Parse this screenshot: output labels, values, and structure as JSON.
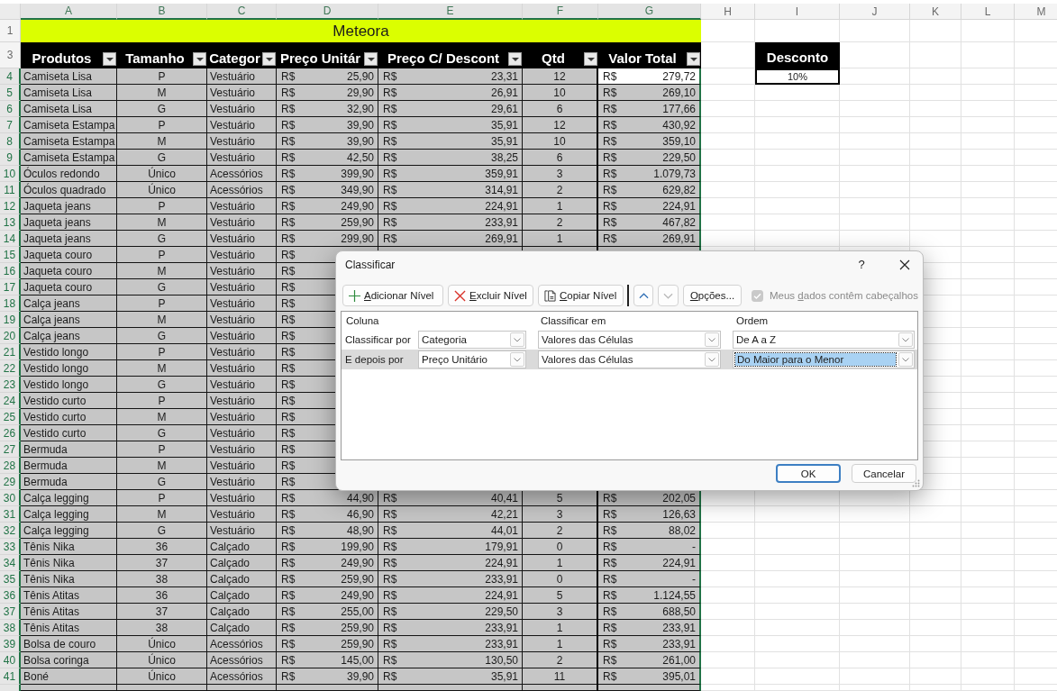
{
  "column_letters": [
    {
      "label": "A",
      "selected": true
    },
    {
      "label": "B",
      "selected": true
    },
    {
      "label": "C",
      "selected": true
    },
    {
      "label": "D",
      "selected": true
    },
    {
      "label": "E",
      "selected": true
    },
    {
      "label": "F",
      "selected": true
    },
    {
      "label": "G",
      "selected": true
    },
    {
      "label": "H",
      "selected": false
    },
    {
      "label": "I",
      "selected": false
    },
    {
      "label": "J",
      "selected": false
    },
    {
      "label": "K",
      "selected": false
    },
    {
      "label": "L",
      "selected": false
    },
    {
      "label": "M",
      "selected": false
    }
  ],
  "title_row": {
    "n": "1",
    "selected": false,
    "title": "Meteora"
  },
  "header_row": {
    "n": "3",
    "selected": false,
    "headers": [
      "Produtos",
      "Tamanho",
      "Categor",
      "Preço Unitár",
      "Preço C/ Descont",
      "Qtd",
      "Valor Total"
    ]
  },
  "discount": {
    "header": "Desconto",
    "value": "10%"
  },
  "rows": [
    {
      "n": "4",
      "selected": true,
      "produto": "Camiseta Lisa",
      "tamanho": "P",
      "categoria": "Vestuário",
      "preco_unitario": {
        "currency": "R$",
        "value": "25,90"
      },
      "preco_desconto": {
        "currency": "R$",
        "value": "23,31"
      },
      "qtd": "12",
      "valor_total": {
        "currency": "R$",
        "value": "279,72",
        "active": true
      }
    },
    {
      "n": "5",
      "selected": true,
      "produto": "Camiseta Lisa",
      "tamanho": "M",
      "categoria": "Vestuário",
      "preco_unitario": {
        "currency": "R$",
        "value": "29,90"
      },
      "preco_desconto": {
        "currency": "R$",
        "value": "26,91"
      },
      "qtd": "10",
      "valor_total": {
        "currency": "R$",
        "value": "269,10",
        "active": false
      }
    },
    {
      "n": "6",
      "selected": true,
      "produto": "Camiseta Lisa",
      "tamanho": "G",
      "categoria": "Vestuário",
      "preco_unitario": {
        "currency": "R$",
        "value": "32,90"
      },
      "preco_desconto": {
        "currency": "R$",
        "value": "29,61"
      },
      "qtd": "6",
      "valor_total": {
        "currency": "R$",
        "value": "177,66",
        "active": false
      }
    },
    {
      "n": "7",
      "selected": true,
      "produto": "Camiseta Estampa",
      "tamanho": "P",
      "categoria": "Vestuário",
      "preco_unitario": {
        "currency": "R$",
        "value": "39,90"
      },
      "preco_desconto": {
        "currency": "R$",
        "value": "35,91"
      },
      "qtd": "12",
      "valor_total": {
        "currency": "R$",
        "value": "430,92",
        "active": false
      }
    },
    {
      "n": "8",
      "selected": true,
      "produto": "Camiseta Estampa",
      "tamanho": "M",
      "categoria": "Vestuário",
      "preco_unitario": {
        "currency": "R$",
        "value": "39,90"
      },
      "preco_desconto": {
        "currency": "R$",
        "value": "35,91"
      },
      "qtd": "10",
      "valor_total": {
        "currency": "R$",
        "value": "359,10",
        "active": false
      }
    },
    {
      "n": "9",
      "selected": true,
      "produto": "Camiseta Estampa",
      "tamanho": "G",
      "categoria": "Vestuário",
      "preco_unitario": {
        "currency": "R$",
        "value": "42,50"
      },
      "preco_desconto": {
        "currency": "R$",
        "value": "38,25"
      },
      "qtd": "6",
      "valor_total": {
        "currency": "R$",
        "value": "229,50",
        "active": false
      }
    },
    {
      "n": "10",
      "selected": true,
      "produto": "Óculos redondo",
      "tamanho": "Único",
      "categoria": "Acessórios",
      "preco_unitario": {
        "currency": "R$",
        "value": "399,90"
      },
      "preco_desconto": {
        "currency": "R$",
        "value": "359,91"
      },
      "qtd": "3",
      "valor_total": {
        "currency": "R$",
        "value": "1.079,73",
        "active": false
      }
    },
    {
      "n": "11",
      "selected": true,
      "produto": "Óculos quadrado",
      "tamanho": "Único",
      "categoria": "Acessórios",
      "preco_unitario": {
        "currency": "R$",
        "value": "349,90"
      },
      "preco_desconto": {
        "currency": "R$",
        "value": "314,91"
      },
      "qtd": "2",
      "valor_total": {
        "currency": "R$",
        "value": "629,82",
        "active": false
      }
    },
    {
      "n": "12",
      "selected": true,
      "produto": "Jaqueta jeans",
      "tamanho": "P",
      "categoria": "Vestuário",
      "preco_unitario": {
        "currency": "R$",
        "value": "249,90"
      },
      "preco_desconto": {
        "currency": "R$",
        "value": "224,91"
      },
      "qtd": "1",
      "valor_total": {
        "currency": "R$",
        "value": "224,91",
        "active": false
      }
    },
    {
      "n": "13",
      "selected": true,
      "produto": "Jaqueta jeans",
      "tamanho": "M",
      "categoria": "Vestuário",
      "preco_unitario": {
        "currency": "R$",
        "value": "259,90"
      },
      "preco_desconto": {
        "currency": "R$",
        "value": "233,91"
      },
      "qtd": "2",
      "valor_total": {
        "currency": "R$",
        "value": "467,82",
        "active": false
      }
    },
    {
      "n": "14",
      "selected": true,
      "produto": "Jaqueta jeans",
      "tamanho": "G",
      "categoria": "Vestuário",
      "preco_unitario": {
        "currency": "R$",
        "value": "299,90"
      },
      "preco_desconto": {
        "currency": "R$",
        "value": "269,91"
      },
      "qtd": "1",
      "valor_total": {
        "currency": "R$",
        "value": "269,91",
        "active": false
      }
    },
    {
      "n": "15",
      "selected": true,
      "produto": "Jaqueta couro",
      "tamanho": "P",
      "categoria": "Vestuário",
      "preco_unitario": {
        "currency": "R$"
      }
    },
    {
      "n": "16",
      "selected": true,
      "produto": "Jaqueta couro",
      "tamanho": "M",
      "categoria": "Vestuário",
      "preco_unitario": {
        "currency": "R$"
      }
    },
    {
      "n": "17",
      "selected": true,
      "produto": "Jaqueta couro",
      "tamanho": "G",
      "categoria": "Vestuário",
      "preco_unitario": {
        "currency": "R$"
      }
    },
    {
      "n": "18",
      "selected": true,
      "produto": "Calça jeans",
      "tamanho": "P",
      "categoria": "Vestuário",
      "preco_unitario": {
        "currency": "R$"
      }
    },
    {
      "n": "19",
      "selected": true,
      "produto": "Calça jeans",
      "tamanho": "M",
      "categoria": "Vestuário",
      "preco_unitario": {
        "currency": "R$"
      }
    },
    {
      "n": "20",
      "selected": true,
      "produto": "Calça jeans",
      "tamanho": "G",
      "categoria": "Vestuário",
      "preco_unitario": {
        "currency": "R$"
      }
    },
    {
      "n": "21",
      "selected": true,
      "produto": "Vestido longo",
      "tamanho": "P",
      "categoria": "Vestuário",
      "preco_unitario": {
        "currency": "R$"
      }
    },
    {
      "n": "22",
      "selected": true,
      "produto": "Vestido longo",
      "tamanho": "M",
      "categoria": "Vestuário",
      "preco_unitario": {
        "currency": "R$"
      }
    },
    {
      "n": "23",
      "selected": true,
      "produto": "Vestido longo",
      "tamanho": "G",
      "categoria": "Vestuário",
      "preco_unitario": {
        "currency": "R$"
      }
    },
    {
      "n": "24",
      "selected": true,
      "produto": "Vestido curto",
      "tamanho": "P",
      "categoria": "Vestuário",
      "preco_unitario": {
        "currency": "R$"
      }
    },
    {
      "n": "25",
      "selected": true,
      "produto": "Vestido curto",
      "tamanho": "M",
      "categoria": "Vestuário",
      "preco_unitario": {
        "currency": "R$"
      }
    },
    {
      "n": "26",
      "selected": true,
      "produto": "Vestido curto",
      "tamanho": "G",
      "categoria": "Vestuário",
      "preco_unitario": {
        "currency": "R$"
      }
    },
    {
      "n": "27",
      "selected": true,
      "produto": "Bermuda",
      "tamanho": "P",
      "categoria": "Vestuário",
      "preco_unitario": {
        "currency": "R$"
      }
    },
    {
      "n": "28",
      "selected": true,
      "produto": "Bermuda",
      "tamanho": "M",
      "categoria": "Vestuário",
      "preco_unitario": {
        "currency": "R$"
      }
    },
    {
      "n": "29",
      "selected": true,
      "produto": "Bermuda",
      "tamanho": "G",
      "categoria": "Vestuário",
      "preco_unitario": {
        "currency": "R$"
      }
    },
    {
      "n": "30",
      "selected": true,
      "produto": "Calça legging",
      "tamanho": "P",
      "categoria": "Vestuário",
      "preco_unitario": {
        "currency": "R$",
        "value": "44,90"
      },
      "preco_desconto": {
        "currency": "R$",
        "value": "40,41"
      },
      "qtd": "5",
      "valor_total": {
        "currency": "R$",
        "value": "202,05",
        "active": false
      }
    },
    {
      "n": "31",
      "selected": true,
      "produto": "Calça legging",
      "tamanho": "M",
      "categoria": "Vestuário",
      "preco_unitario": {
        "currency": "R$",
        "value": "46,90"
      },
      "preco_desconto": {
        "currency": "R$",
        "value": "42,21"
      },
      "qtd": "3",
      "valor_total": {
        "currency": "R$",
        "value": "126,63",
        "active": false
      }
    },
    {
      "n": "32",
      "selected": true,
      "produto": "Calça legging",
      "tamanho": "G",
      "categoria": "Vestuário",
      "preco_unitario": {
        "currency": "R$",
        "value": "48,90"
      },
      "preco_desconto": {
        "currency": "R$",
        "value": "44,01"
      },
      "qtd": "2",
      "valor_total": {
        "currency": "R$",
        "value": "88,02",
        "active": false
      }
    },
    {
      "n": "33",
      "selected": true,
      "produto": "Tênis Nika",
      "tamanho": "36",
      "categoria": "Calçado",
      "preco_unitario": {
        "currency": "R$",
        "value": "199,90"
      },
      "preco_desconto": {
        "currency": "R$",
        "value": "179,91"
      },
      "qtd": "0",
      "valor_total": {
        "currency": "R$",
        "value": "-",
        "active": false
      }
    },
    {
      "n": "34",
      "selected": true,
      "produto": "Tênis Nika",
      "tamanho": "37",
      "categoria": "Calçado",
      "preco_unitario": {
        "currency": "R$",
        "value": "249,90"
      },
      "preco_desconto": {
        "currency": "R$",
        "value": "224,91"
      },
      "qtd": "1",
      "valor_total": {
        "currency": "R$",
        "value": "224,91",
        "active": false
      }
    },
    {
      "n": "35",
      "selected": true,
      "produto": "Tênis Nika",
      "tamanho": "38",
      "categoria": "Calçado",
      "preco_unitario": {
        "currency": "R$",
        "value": "259,90"
      },
      "preco_desconto": {
        "currency": "R$",
        "value": "233,91"
      },
      "qtd": "0",
      "valor_total": {
        "currency": "R$",
        "value": "-",
        "active": false
      }
    },
    {
      "n": "36",
      "selected": true,
      "produto": "Tênis Atitas",
      "tamanho": "36",
      "categoria": "Calçado",
      "preco_unitario": {
        "currency": "R$",
        "value": "249,90"
      },
      "preco_desconto": {
        "currency": "R$",
        "value": "224,91"
      },
      "qtd": "5",
      "valor_total": {
        "currency": "R$",
        "value": "1.124,55",
        "active": false
      }
    },
    {
      "n": "37",
      "selected": true,
      "produto": "Tênis Atitas",
      "tamanho": "37",
      "categoria": "Calçado",
      "preco_unitario": {
        "currency": "R$",
        "value": "255,00"
      },
      "preco_desconto": {
        "currency": "R$",
        "value": "229,50"
      },
      "qtd": "3",
      "valor_total": {
        "currency": "R$",
        "value": "688,50",
        "active": false
      }
    },
    {
      "n": "38",
      "selected": true,
      "produto": "Tênis Atitas",
      "tamanho": "38",
      "categoria": "Calçado",
      "preco_unitario": {
        "currency": "R$",
        "value": "259,90"
      },
      "preco_desconto": {
        "currency": "R$",
        "value": "233,91"
      },
      "qtd": "1",
      "valor_total": {
        "currency": "R$",
        "value": "233,91",
        "active": false
      }
    },
    {
      "n": "39",
      "selected": true,
      "produto": "Bolsa de couro",
      "tamanho": "Único",
      "categoria": "Acessórios",
      "preco_unitario": {
        "currency": "R$",
        "value": "259,90"
      },
      "preco_desconto": {
        "currency": "R$",
        "value": "233,91"
      },
      "qtd": "1",
      "valor_total": {
        "currency": "R$",
        "value": "233,91",
        "active": false
      }
    },
    {
      "n": "40",
      "selected": true,
      "produto": "Bolsa coringa",
      "tamanho": "Único",
      "categoria": "Acessórios",
      "preco_unitario": {
        "currency": "R$",
        "value": "145,00"
      },
      "preco_desconto": {
        "currency": "R$",
        "value": "130,50"
      },
      "qtd": "2",
      "valor_total": {
        "currency": "R$",
        "value": "261,00",
        "active": false
      }
    },
    {
      "n": "41",
      "selected": true,
      "produto": "Boné",
      "tamanho": "Único",
      "categoria": "Acessórios",
      "preco_unitario": {
        "currency": "R$",
        "value": "39,90"
      },
      "preco_desconto": {
        "currency": "R$",
        "value": "35,91"
      },
      "qtd": "11",
      "valor_total": {
        "currency": "R$",
        "value": "395,01",
        "active": false
      }
    }
  ],
  "dialog": {
    "title": "Classificar",
    "help": "?",
    "toolbar": [
      {
        "kind": "add",
        "key": "A",
        "post": "dicionar Nível"
      },
      {
        "kind": "delete",
        "key": "E",
        "post": "xcluir Nível"
      },
      {
        "kind": "copy",
        "key": "C",
        "post": "opiar Nível"
      }
    ],
    "move_up": {
      "disabled": false
    },
    "move_down": {
      "disabled": true
    },
    "options": {
      "key": "O",
      "post": "pções..."
    },
    "headers_checkbox": {
      "pre": "Meus ",
      "key": "d",
      "post": "ados contêm cabeçalhos",
      "checked": true,
      "disabled": true
    },
    "columns": [
      "Coluna",
      "Classificar em",
      "Ordem"
    ],
    "levels": [
      {
        "label": "Classificar por",
        "column": "Categoria",
        "sort_on": "Valores das Células",
        "order": "De A a Z",
        "selected": false
      },
      {
        "label": "E depois por",
        "column": "Preço Unitário",
        "sort_on": "Valores das Células",
        "order": "Do Maior para o Menor",
        "selected": true
      }
    ],
    "buttons": [
      {
        "label": "OK",
        "default": true
      },
      {
        "label": "Cancelar",
        "default": false
      }
    ]
  }
}
